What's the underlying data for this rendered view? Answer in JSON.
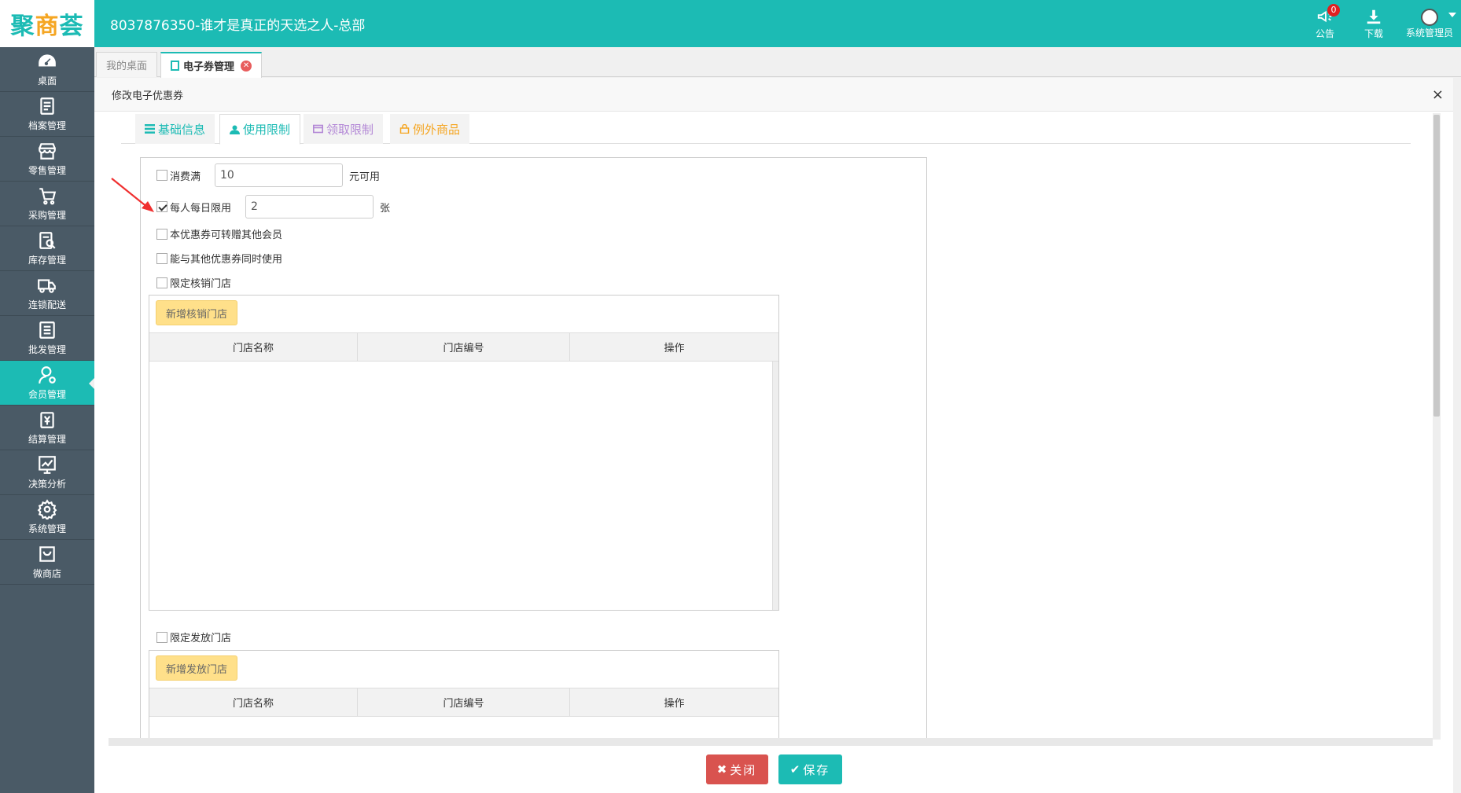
{
  "app": {
    "logo_left": "聚",
    "logo_mid": "商",
    "logo_right": "荟",
    "title": "8037876350-谁才是真正的天选之人-总部"
  },
  "top_actions": {
    "notice_label": "公告",
    "notice_count": "0",
    "download_label": "下载",
    "user_label": "系统管理员"
  },
  "sidebar": {
    "items": [
      {
        "label": "桌面",
        "icon": "dashboard-icon"
      },
      {
        "label": "档案管理",
        "icon": "archive-icon"
      },
      {
        "label": "零售管理",
        "icon": "store-icon"
      },
      {
        "label": "采购管理",
        "icon": "cart-icon"
      },
      {
        "label": "库存管理",
        "icon": "inventory-icon"
      },
      {
        "label": "连锁配送",
        "icon": "truck-icon"
      },
      {
        "label": "批发管理",
        "icon": "wholesale-icon"
      },
      {
        "label": "会员管理",
        "icon": "member-icon"
      },
      {
        "label": "结算管理",
        "icon": "settlement-icon"
      },
      {
        "label": "决策分析",
        "icon": "chart-icon"
      },
      {
        "label": "系统管理",
        "icon": "gear-icon"
      },
      {
        "label": "微商店",
        "icon": "shop-bag-icon"
      }
    ],
    "active_index": 7
  },
  "page_tabs": [
    {
      "label": "我的桌面"
    },
    {
      "label": "电子券管理"
    }
  ],
  "dialog": {
    "title": "修改电子优惠券",
    "close_symbol": "×"
  },
  "inner_tabs": [
    {
      "label": "基础信息",
      "color": "#1cbbb4"
    },
    {
      "label": "使用限制",
      "color": "#1cbbb4"
    },
    {
      "label": "领取限制",
      "color": "#b388d6"
    },
    {
      "label": "例外商品",
      "color": "#f5a623"
    }
  ],
  "form": {
    "spend_min_label": "消费满",
    "spend_min_value": "10",
    "spend_min_suffix": "元可用",
    "daily_limit_label": "每人每日限用",
    "daily_limit_value": "2",
    "daily_limit_suffix": "张",
    "transferable_label": "本优惠券可转赠其他会员",
    "combinable_label": "能与其他优惠券同时使用",
    "limit_redeem_store_label": "限定核销门店",
    "add_redeem_store_button": "新增核销门店",
    "limit_issue_store_label": "限定发放门店",
    "add_issue_store_button": "新增发放门店",
    "table_columns": [
      "门店名称",
      "门店编号",
      "操作"
    ]
  },
  "footer": {
    "close_label": "关闭",
    "save_label": "保存"
  },
  "colors": {
    "brand": "#1cbbb4",
    "sidebar": "#4a5a66",
    "danger": "#d9534f",
    "warning_button": "#ffe08a"
  }
}
